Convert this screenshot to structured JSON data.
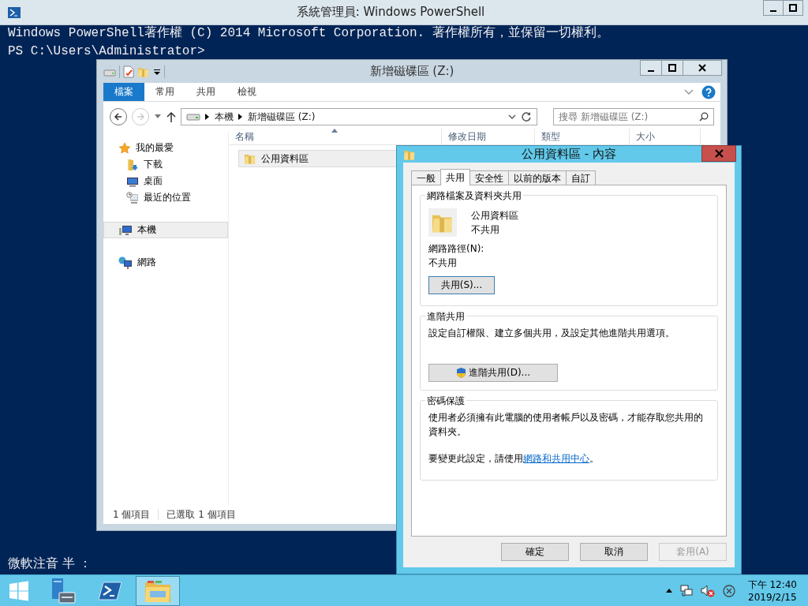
{
  "console": {
    "title": "系統管理員: Windows PowerShell",
    "lines": [
      "Windows PowerShell著作權 (C) 2014 Microsoft Corporation. 著作權所有，並保留一切權利。",
      "PS C:\\Users\\Administrator>"
    ],
    "ime": "微軟注音 半 ："
  },
  "explorer": {
    "title": "新增磁碟區 (Z:)",
    "ribbon_tabs": [
      {
        "label": "檔案",
        "selected": true
      },
      {
        "label": "常用",
        "selected": false
      },
      {
        "label": "共用",
        "selected": false
      },
      {
        "label": "檢視",
        "selected": false
      }
    ],
    "address": [
      "本機",
      "新增磁碟區 (Z:)"
    ],
    "search": {
      "placeholder": "搜尋 新增磁碟區 (Z:)"
    },
    "nav": [
      {
        "label": "我的最愛",
        "kind": "favorites",
        "selected": false,
        "children": [
          {
            "label": "下載",
            "kind": "downloads",
            "selected": false
          },
          {
            "label": "桌面",
            "kind": "desktop",
            "selected": false
          },
          {
            "label": "最近的位置",
            "kind": "recent",
            "selected": false
          }
        ]
      },
      {
        "label": "本機",
        "kind": "computer",
        "selected": true
      },
      {
        "label": "網路",
        "kind": "network",
        "selected": false
      }
    ],
    "columns": [
      "名稱",
      "修改日期",
      "類型",
      "大小"
    ],
    "files": [
      {
        "name": "公用資料區",
        "selected": true
      }
    ],
    "status_bar": [
      "1 個項目",
      "已選取 1 個項目"
    ]
  },
  "dialog": {
    "title": "公用資料區 - 內容",
    "tabs": [
      {
        "label": "一般",
        "selected": false
      },
      {
        "label": "共用",
        "selected": true
      },
      {
        "label": "安全性",
        "selected": false
      },
      {
        "label": "以前的版本",
        "selected": false
      },
      {
        "label": "自訂",
        "selected": false
      }
    ],
    "network_sharing": {
      "title": "網路檔案及資料夾共用",
      "item_name": "公用資料區",
      "item_status": "不共用",
      "path_label": "網路路徑(N):",
      "path_value": "不共用",
      "button": "共用(S)..."
    },
    "advanced_sharing": {
      "title": "進階共用",
      "text": "設定自訂權限、建立多個共用，及設定其他進階共用選項。",
      "button": "進階共用(D)..."
    },
    "password_protection": {
      "title": "密碼保護",
      "text": "使用者必須擁有此電腦的使用者帳戶以及密碼，才能存取您共用的資料夾。",
      "change_text": "要變更此設定，請使用",
      "link": "網路和共用中心",
      "link_after": "。"
    },
    "buttons": [
      {
        "label": "確定",
        "disabled": false
      },
      {
        "label": "取消",
        "disabled": false
      },
      {
        "label": "套用(A)",
        "disabled": true
      }
    ]
  },
  "taskbar": {
    "apps": [
      {
        "kind": "server-manager",
        "selected": false
      },
      {
        "kind": "powershell",
        "selected": false
      },
      {
        "kind": "explorer",
        "selected": true
      }
    ],
    "time": "下午 12:40",
    "date": "2019/2/15"
  }
}
